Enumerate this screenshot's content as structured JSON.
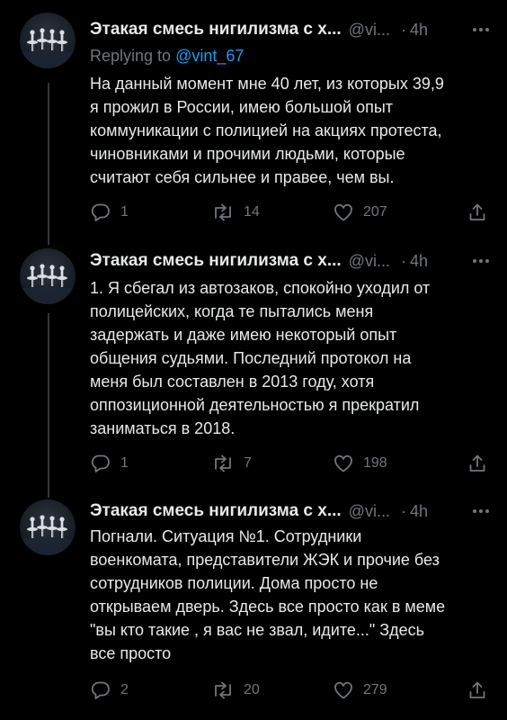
{
  "colors": {
    "background": "#000000",
    "text": "#e7e9ea",
    "muted": "#71767b",
    "accent": "#1d9bf0",
    "thread_line": "#333639"
  },
  "tweets": [
    {
      "author_name": "Этакая смесь нигилизма с х...",
      "author_handle": "@vi...",
      "dot": "·",
      "timestamp": "4h",
      "replying_prefix": "Replying to",
      "replying_mention": "@vint_67",
      "lines": [
        "На данный момент мне 40 лет, из которых 39,9",
        "я прожил в России, имею большой опыт",
        "коммуникации с полицией на акциях протеста,",
        "чиновниками и прочими людьми, которые",
        "считают себя сильнее и правее, чем вы."
      ],
      "reply_count": "1",
      "retweet_count": "14",
      "like_count": "207"
    },
    {
      "author_name": "Этакая смесь нигилизма с х...",
      "author_handle": "@vi...",
      "dot": "·",
      "timestamp": "4h",
      "lines": [
        "1. Я сбегал из автозаков, спокойно уходил от",
        "полицейских, когда те пытались меня",
        "задержать и даже имею некоторый опыт",
        "общения судьями. Последний протокол на",
        "меня был составлен в 2013 году, хотя",
        "оппозиционной деятельностью я прекратил",
        "заниматься в 2018."
      ],
      "reply_count": "1",
      "retweet_count": "7",
      "like_count": "198"
    },
    {
      "author_name": "Этакая смесь нигилизма с х...",
      "author_handle": "@vi...",
      "dot": "·",
      "timestamp": "4h",
      "lines": [
        "Погнали. Ситуация №1. Сотрудники",
        "военкомата, представители ЖЭК и прочие без",
        "сотрудников полиции. Дома просто не",
        "открываем дверь. Здесь все просто как в меме",
        "\"вы кто такие , я вас не звал, идите...\" Здесь",
        "все просто"
      ],
      "reply_count": "2",
      "retweet_count": "20",
      "like_count": "279"
    }
  ],
  "icons": {
    "more": "more-horizontal-icon",
    "reply": "reply-bubble-icon",
    "retweet": "retweet-icon",
    "like": "heart-icon",
    "share": "share-upload-icon",
    "avatar": "ballet-dancers-image"
  }
}
